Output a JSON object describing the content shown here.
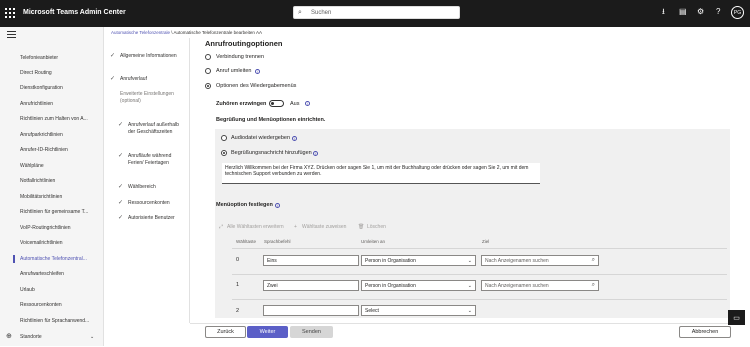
{
  "app": {
    "title": "Microsoft Teams Admin Center",
    "avatar": "PG"
  },
  "search": {
    "placeholder": "Suchen"
  },
  "nav": {
    "items": [
      {
        "label": "Telefonieanbieter"
      },
      {
        "label": "Direct Routing"
      },
      {
        "label": "Dienstkonfiguration"
      },
      {
        "label": "Anrufrichtlinien"
      },
      {
        "label": "Richtlinien zum Halten von A..."
      },
      {
        "label": "Anrufparkrichtlinien"
      },
      {
        "label": "Anrufer-ID-Richtlinien"
      },
      {
        "label": "Wählpläne"
      },
      {
        "label": "Notfallrichtlinien"
      },
      {
        "label": "Mobilitätsrichtlinien"
      },
      {
        "label": "Richtlinien für gemeinsame T..."
      },
      {
        "label": "VoIP-Routingrichtlinien"
      },
      {
        "label": "Voicemailrichtlinien"
      },
      {
        "label": "Automatische Telefonzentral..."
      },
      {
        "label": "Anrufwarteschleifen"
      },
      {
        "label": "Urlaub"
      },
      {
        "label": "Ressourcenkonten"
      },
      {
        "label": "Richtlinien für Sprachanwend..."
      }
    ],
    "footer": {
      "label": "Standorte"
    }
  },
  "breadcrumb": {
    "link": "Automatische Telefonzentrale",
    "sep": " \\ ",
    "current": "Automatische Telefonzentrale bearbeiten AA"
  },
  "steps": [
    {
      "label": "Allgemeine Informationen"
    },
    {
      "label": "Anrufverlauf"
    },
    {
      "label": "Erweiterte Einstellungen (optional)"
    },
    {
      "label": "Anrufverlauf außerhalb der Geschäftszeiten"
    },
    {
      "label": "Anrufläufe während Ferien/ Feiertagen"
    },
    {
      "label": "Wählbereich"
    },
    {
      "label": "Ressourcenkonten"
    },
    {
      "label": "Autorisierte Benutzer"
    }
  ],
  "main": {
    "title": "Anrufroutingoptionen",
    "options": [
      {
        "label": "Verbindung trennen"
      },
      {
        "label": "Anruf umleiten"
      },
      {
        "label": "Optionen des Wiedergabemenüs"
      }
    ],
    "listen": {
      "label": "Zuhören erzwingen",
      "state": "Aus"
    },
    "greeting": {
      "heading": "Begrüßung und Menüoptionen einrichten.",
      "audio_label": "Audiodatei wiedergeben",
      "text_label": "Begrüßungsnachricht hinzufügen",
      "message": "Herzlich Willkommen bei der Firma XYZ. Drücken oder sagen Sie 1, um mit der Buchhaltung oder drücken oder sagen Sie 2, um mit dem technischen Support verbunden zu werden."
    },
    "menu": {
      "heading": "Menüoption festlegen",
      "toolbar": {
        "expand": "Alle Wähltasten erweitern",
        "assign": "Wähltaste zuweisen",
        "delete": "Löschen"
      },
      "columns": {
        "key": "Wähltaste",
        "voice": "Sprachbefehl",
        "redirect": "Umleiten an",
        "target": "Ziel"
      },
      "rows": [
        {
          "key": "0",
          "voice": "Eins",
          "redirect": "Person in Organisation",
          "target_placeholder": "Nach Anzeigenamen suchen"
        },
        {
          "key": "1",
          "voice": "Zwei",
          "redirect": "Person in Organisation",
          "target_placeholder": "Nach Anzeigenamen suchen"
        },
        {
          "key": "2",
          "voice": "",
          "redirect": "Select",
          "target_placeholder": ""
        }
      ]
    }
  },
  "footer": {
    "back": "Zurück",
    "next": "Weiter",
    "send": "Senden",
    "cancel": "Abbrechen"
  }
}
